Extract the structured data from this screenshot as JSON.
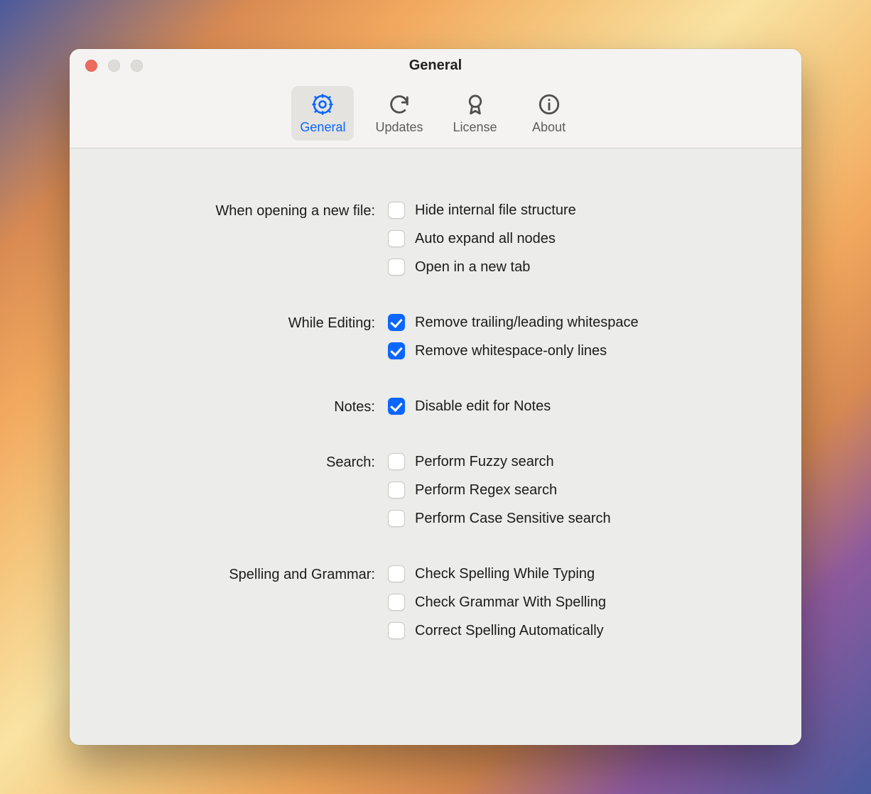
{
  "window": {
    "title": "General"
  },
  "tabs": [
    {
      "label": "General",
      "icon": "gear-icon",
      "active": true
    },
    {
      "label": "Updates",
      "icon": "refresh-icon",
      "active": false
    },
    {
      "label": "License",
      "icon": "badge-icon",
      "active": false
    },
    {
      "label": "About",
      "icon": "info-icon",
      "active": false
    }
  ],
  "sections": {
    "opening": {
      "label": "When opening a new file:",
      "options": [
        {
          "label": "Hide internal file structure",
          "checked": false
        },
        {
          "label": "Auto expand all nodes",
          "checked": false
        },
        {
          "label": "Open in a new tab",
          "checked": false
        }
      ]
    },
    "editing": {
      "label": "While Editing:",
      "options": [
        {
          "label": "Remove trailing/leading whitespace",
          "checked": true
        },
        {
          "label": "Remove whitespace-only lines",
          "checked": true
        }
      ]
    },
    "notes": {
      "label": "Notes:",
      "options": [
        {
          "label": "Disable edit for Notes",
          "checked": true
        }
      ]
    },
    "search": {
      "label": "Search:",
      "options": [
        {
          "label": "Perform Fuzzy search",
          "checked": false
        },
        {
          "label": "Perform Regex search",
          "checked": false
        },
        {
          "label": "Perform Case Sensitive search",
          "checked": false
        }
      ]
    },
    "spelling": {
      "label": "Spelling and Grammar:",
      "options": [
        {
          "label": "Check Spelling While Typing",
          "checked": false
        },
        {
          "label": "Check Grammar With Spelling",
          "checked": false
        },
        {
          "label": "Correct Spelling Automatically",
          "checked": false
        }
      ]
    }
  }
}
